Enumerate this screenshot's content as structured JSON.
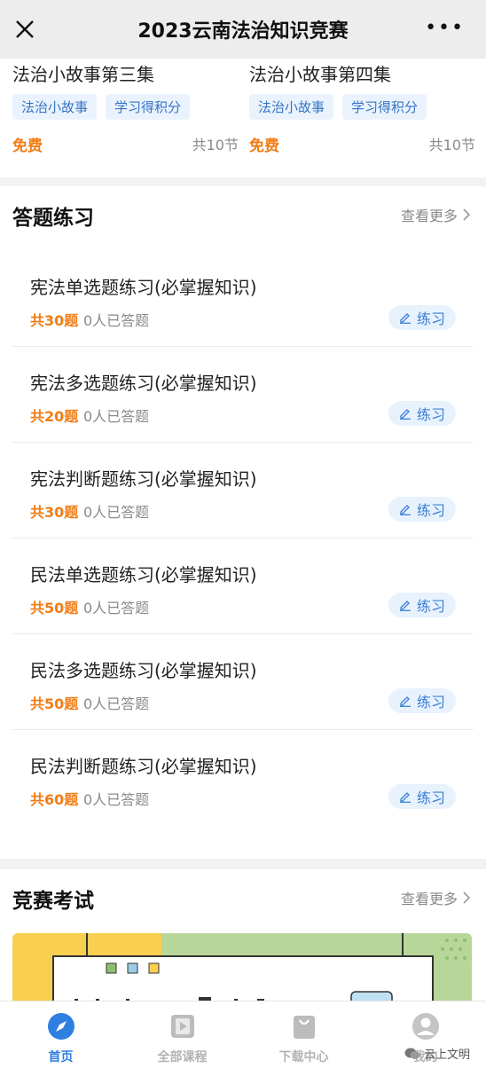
{
  "topbar": {
    "title": "2023云南法治知识竞赛",
    "close_icon": "close-icon",
    "more_icon": "more-icon",
    "more_glyph": "•••"
  },
  "courses": [
    {
      "title": "法治小故事第三集",
      "tags": [
        "法治小故事",
        "学习得积分"
      ],
      "price": "免费",
      "lessons": "共10节"
    },
    {
      "title": "法治小故事第四集",
      "tags": [
        "法治小故事",
        "学习得积分"
      ],
      "price": "免费",
      "lessons": "共10节"
    }
  ],
  "practice": {
    "title": "答题练习",
    "see_more": "查看更多",
    "items": [
      {
        "title": "宪法单选题练习(必掌握知识)",
        "count": "共30题",
        "answered": "0人已答题",
        "button": "练习"
      },
      {
        "title": "宪法多选题练习(必掌握知识)",
        "count": "共20题",
        "answered": "0人已答题",
        "button": "练习"
      },
      {
        "title": "宪法判断题练习(必掌握知识)",
        "count": "共30题",
        "answered": "0人已答题",
        "button": "练习"
      },
      {
        "title": "民法单选题练习(必掌握知识)",
        "count": "共50题",
        "answered": "0人已答题",
        "button": "练习"
      },
      {
        "title": "民法多选题练习(必掌握知识)",
        "count": "共50题",
        "answered": "0人已答题",
        "button": "练习"
      },
      {
        "title": "民法判断题练习(必掌握知识)",
        "count": "共60题",
        "answered": "0人已答题",
        "button": "练习"
      }
    ]
  },
  "exam": {
    "title": "竞赛考试",
    "see_more": "查看更多"
  },
  "tabbar": {
    "items": [
      {
        "label": "首页",
        "icon": "compass-icon",
        "active": true
      },
      {
        "label": "全部课程",
        "icon": "video-icon",
        "active": false
      },
      {
        "label": "下载中心",
        "icon": "bag-icon",
        "active": false
      },
      {
        "label": "我的",
        "icon": "user-icon",
        "active": false
      }
    ]
  },
  "watermark": "云上文明",
  "colors": {
    "accent": "#2f7fe0",
    "price": "#f07d16",
    "tag_bg": "#eaf3fd",
    "tag_text": "#3574c4"
  }
}
